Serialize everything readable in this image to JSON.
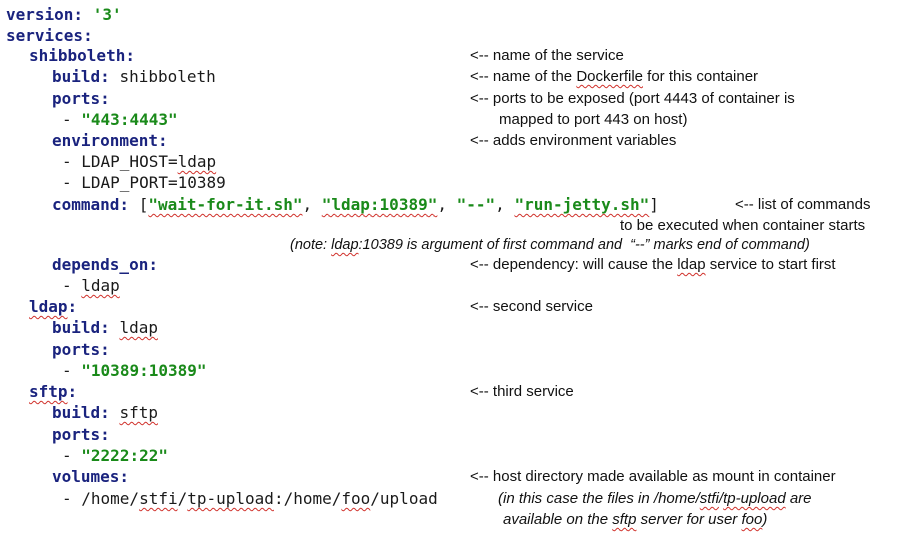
{
  "code": {
    "version_key": "version:",
    "version_val": "'3'",
    "services_key": "services:",
    "shib_key": "shibboleth:",
    "build_key": "build:",
    "shib_build_val": "shibboleth",
    "ports_key": "ports:",
    "dash": "-",
    "shib_port": "\"443:4443\"",
    "env_key": "environment:",
    "env_1": "- LDAP_HOST=",
    "env_1b": "ldap",
    "env_2": "- LDAP_PORT=10389",
    "command_key": "command:",
    "cmd_open": "[",
    "cmd_1": "\"wait-for-it.sh\"",
    "cmd_2": "\"ldap:10389\"",
    "cmd_3": "\"--\"",
    "cmd_4": "\"run-jetty.sh\"",
    "cmd_sep": ",",
    "cmd_close": "]",
    "depends_key": "depends_on:",
    "depends_val": "ldap",
    "ldap_key": "ldap",
    "colon": ":",
    "ldap_build_val": "ldap",
    "ldap_port": "\"10389:10389\"",
    "sftp_key": "sftp",
    "sftp_build_val": "sftp",
    "sftp_port": "\"2222:22\"",
    "volumes_key": "volumes:",
    "vol_a": "- /home/",
    "vol_b": "stfi",
    "vol_c": "/",
    "vol_d": "tp-upload",
    "vol_e": ":/home/",
    "vol_f": "foo",
    "vol_g": "/upload"
  },
  "notes": {
    "n1": "<-- name of the service",
    "n2a": "<-- name of the ",
    "n2b": "Dockerfile",
    "n2c": " for this container",
    "n3": "<-- ports to be exposed (port 4443 of container is",
    "n3b": "mapped to port 443 on host)",
    "n4": "<-- adds environment variables",
    "n5": "<-- list of commands",
    "n5b": "to be executed when container starts",
    "n6a": "(note: ",
    "n6b": "ldap",
    "n6c": ":10389 is argument of first command and  “--” marks end of command)",
    "n7a": "<-- dependency: will cause the ",
    "n7b": "ldap",
    "n7c": " service to start first",
    "n8": "<-- second service",
    "n9": "<-- third service",
    "n10": "<-- host directory made available as mount in container",
    "n11a": "(in this case the files in /home/",
    "n11b": "stfi",
    "n11c": "/",
    "n11d": "tp-upload",
    "n11e": " are",
    "n12a": "available on the ",
    "n12b": "sftp",
    "n12c": " server for user ",
    "n12d": "foo",
    "n12e": ")"
  }
}
